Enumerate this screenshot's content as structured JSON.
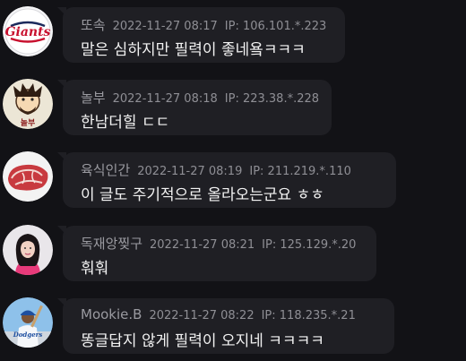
{
  "comments": [
    {
      "nickname": "또속",
      "date": "2022-11-27 08:17",
      "ip": "IP: 106.101.*.223",
      "text": "말은 심하지만 필력이 좋네욬ㅋㅋㅋ",
      "avatar_icon": "giants-logo-icon"
    },
    {
      "nickname": "놀부",
      "date": "2022-11-27 08:18",
      "ip": "IP: 223.38.*.228",
      "text": "한남더힐 ㄷㄷ",
      "avatar_icon": "nolbu-logo-icon"
    },
    {
      "nickname": "육식인간",
      "date": "2022-11-27 08:19",
      "ip": "IP: 211.219.*.110",
      "text": "이 글도 주기적으로 올라오는군요 ㅎㅎ",
      "avatar_icon": "meat-icon"
    },
    {
      "nickname": "독재앙찢구",
      "date": "2022-11-27 08:21",
      "ip": "IP: 125.129.*.20",
      "text": "훠훠",
      "avatar_icon": "woman-portrait-icon"
    },
    {
      "nickname": "Mookie.B",
      "date": "2022-11-27 08:22",
      "ip": "IP: 118.235.*.21",
      "text": "똥글답지 않게 필력이 오지네 ㅋㅋㅋㅋ",
      "avatar_icon": "baseball-player-icon"
    }
  ],
  "colors": {
    "background": "#121216",
    "bubble": "#1f1f24",
    "meta_text": "#8f8f95",
    "body_text": "#f2f2f2"
  }
}
